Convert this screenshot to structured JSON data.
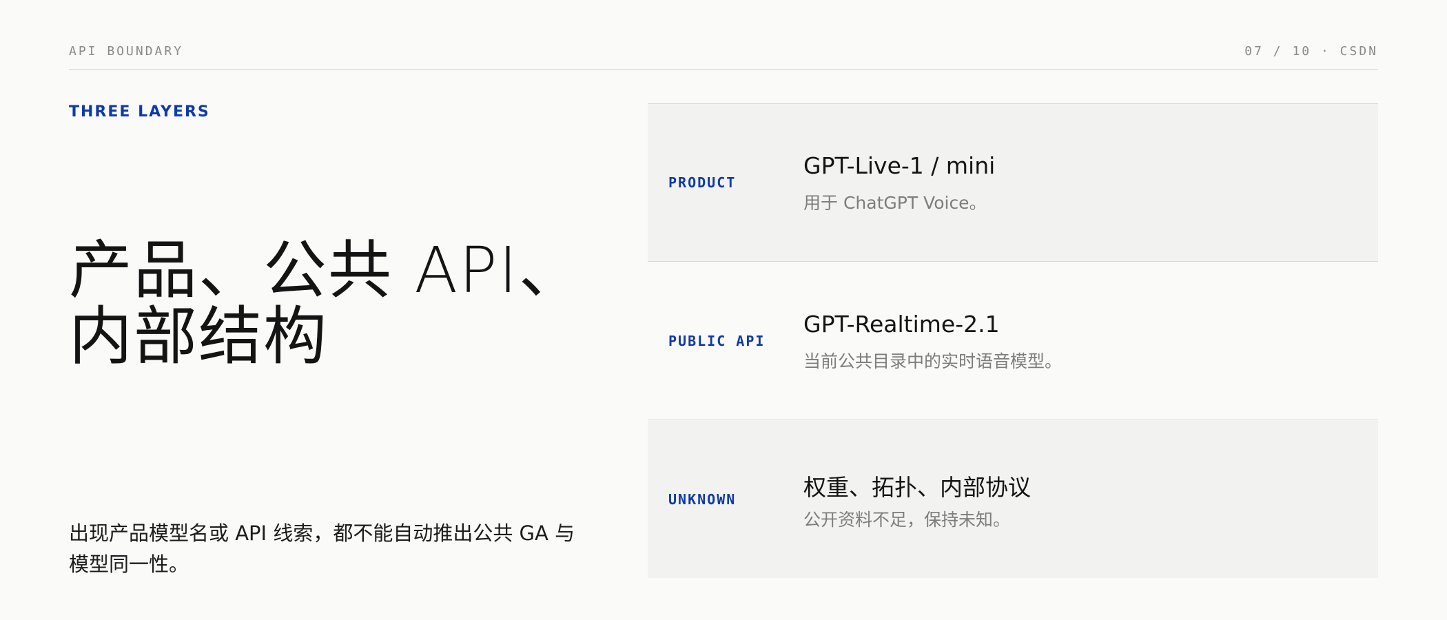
{
  "header": {
    "section": "API BOUNDARY",
    "page_info": "07 / 10 · CSDN"
  },
  "kicker": "THREE LAYERS",
  "title_lines": [
    "产品、公共 API、",
    "内部结构"
  ],
  "summary": "出现产品模型名或 API 线索，都不能自动推出公共 GA 与模型同一性。",
  "layers": [
    {
      "tag": "PRODUCT",
      "name": "GPT-Live-1 / mini",
      "desc": "用于 ChatGPT Voice。"
    },
    {
      "tag": "PUBLIC API",
      "name": "GPT-Realtime-2.1",
      "desc": "当前公共目录中的实时语音模型。"
    },
    {
      "tag": "UNKNOWN",
      "name": "权重、拓扑、内部协议",
      "desc": "公开资料不足，保持未知。"
    }
  ],
  "colors": {
    "accent": "#0f3aa8",
    "background": "#fafaf9",
    "shaded_row": "#f2f2f1",
    "muted_text": "#7d7d7d"
  }
}
